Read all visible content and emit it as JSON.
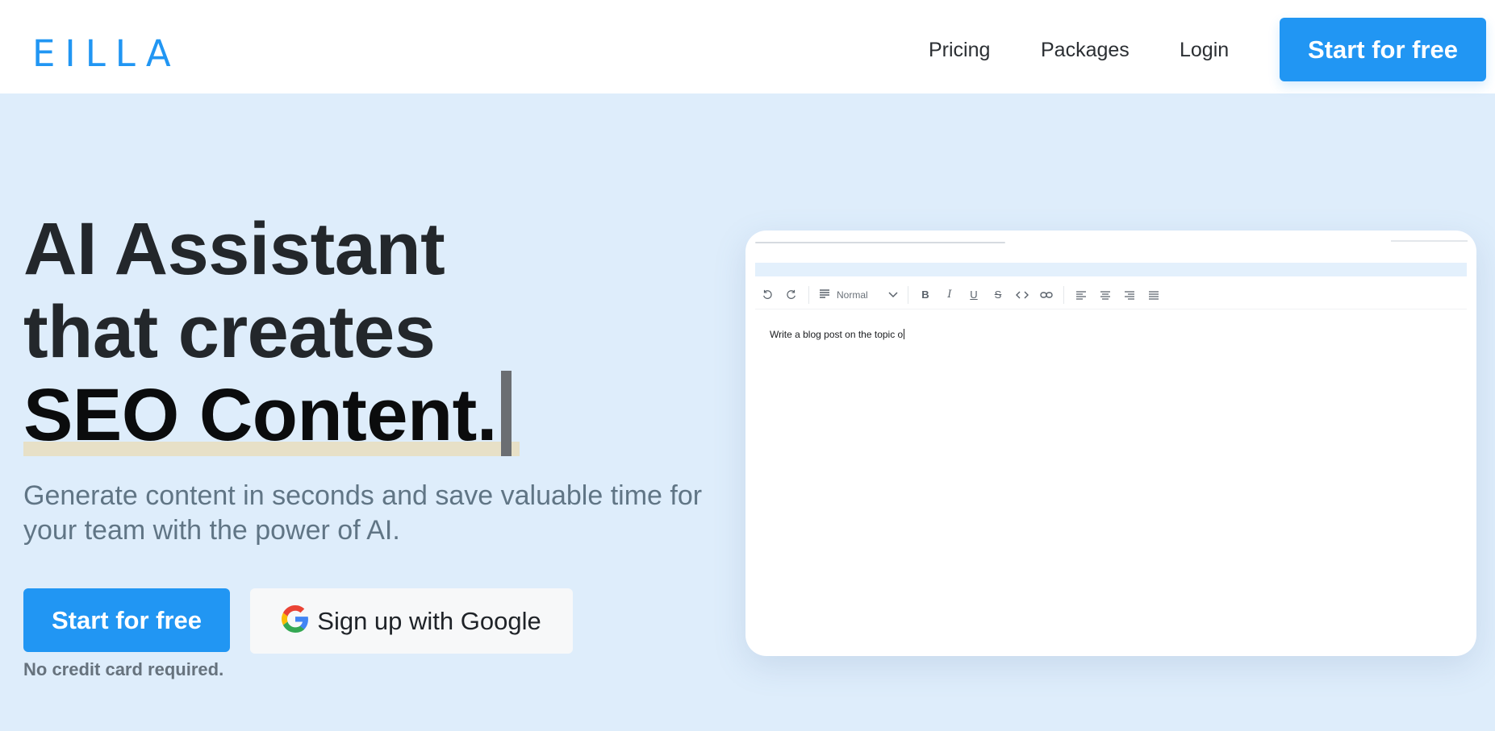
{
  "header": {
    "logo_text": "EILLA",
    "nav": {
      "pricing": "Pricing",
      "packages": "Packages",
      "login": "Login"
    },
    "cta_label": "Start for free"
  },
  "hero": {
    "headline_line1": "AI Assistant",
    "headline_line2": "that creates",
    "headline_line3": "SEO Content.",
    "subtext": "Generate content in seconds and save valuable time for your team with the power of AI.",
    "primary_button": "Start for free",
    "google_button": "Sign up with Google",
    "note": "No credit card required."
  },
  "editor": {
    "format_select_value": "Normal",
    "content_text": "Write a blog post on the topic o",
    "toolbar_icons": [
      "undo-icon",
      "redo-icon",
      "paragraph-icon",
      "chevron-down-icon",
      "bold-icon",
      "italic-icon",
      "underline-icon",
      "strikethrough-icon",
      "code-icon",
      "link-icon",
      "align-left-icon",
      "align-center-icon",
      "align-right-icon",
      "align-justify-icon"
    ]
  },
  "colors": {
    "accent": "#2196f3",
    "page_background": "#deedfb",
    "highlight": "#e7e0c7",
    "subtext": "#607585"
  }
}
